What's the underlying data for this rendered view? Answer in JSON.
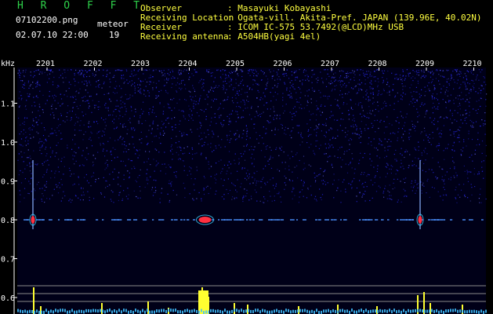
{
  "app": {
    "title": "H R O F F T"
  },
  "file": {
    "name": "07102200.png",
    "datetime": "02.07.10 22:00"
  },
  "meteor": {
    "label": "meteor",
    "count": "19"
  },
  "info": {
    "observer_label": "Observer",
    "observer_value": ": Masayuki Kobayashi",
    "location_label": "Receiving Location",
    "location_value": ": Ogata-vill. Akita-Pref. JAPAN (139.96E, 40.02N)",
    "receiver_label": "Receiver",
    "receiver_value": ": ICOM IC-575 53.7492(@LCD)MHz USB",
    "antenna_label": "Receiving antenna",
    "antenna_value": ": A504HB(yagi 4el)"
  },
  "chart_data": {
    "type": "heatmap",
    "xlabel": "",
    "ylabel": "kHz",
    "x_ticks": [
      "2201",
      "2202",
      "2203",
      "2204",
      "2205",
      "2206",
      "2207",
      "2208",
      "2209",
      "2210"
    ],
    "y_ticks": [
      "1.1",
      "1.0",
      "0.9",
      "0.8",
      "0.7",
      "0.6"
    ],
    "ylim": [
      0.6,
      1.15
    ],
    "carrier_khz": 0.8,
    "events": [
      {
        "time": "2201",
        "strength": "strong"
      },
      {
        "time": "2204",
        "strength": "strongest"
      },
      {
        "time": "2209",
        "strength": "strong"
      }
    ],
    "colors": {
      "background": "#000018",
      "noise": "#2a2aff",
      "echo": "#ff3040",
      "detector_bars": "#ffff30",
      "baseline": "#40c0ff",
      "threshold_lines": "#8a8a8a"
    }
  }
}
